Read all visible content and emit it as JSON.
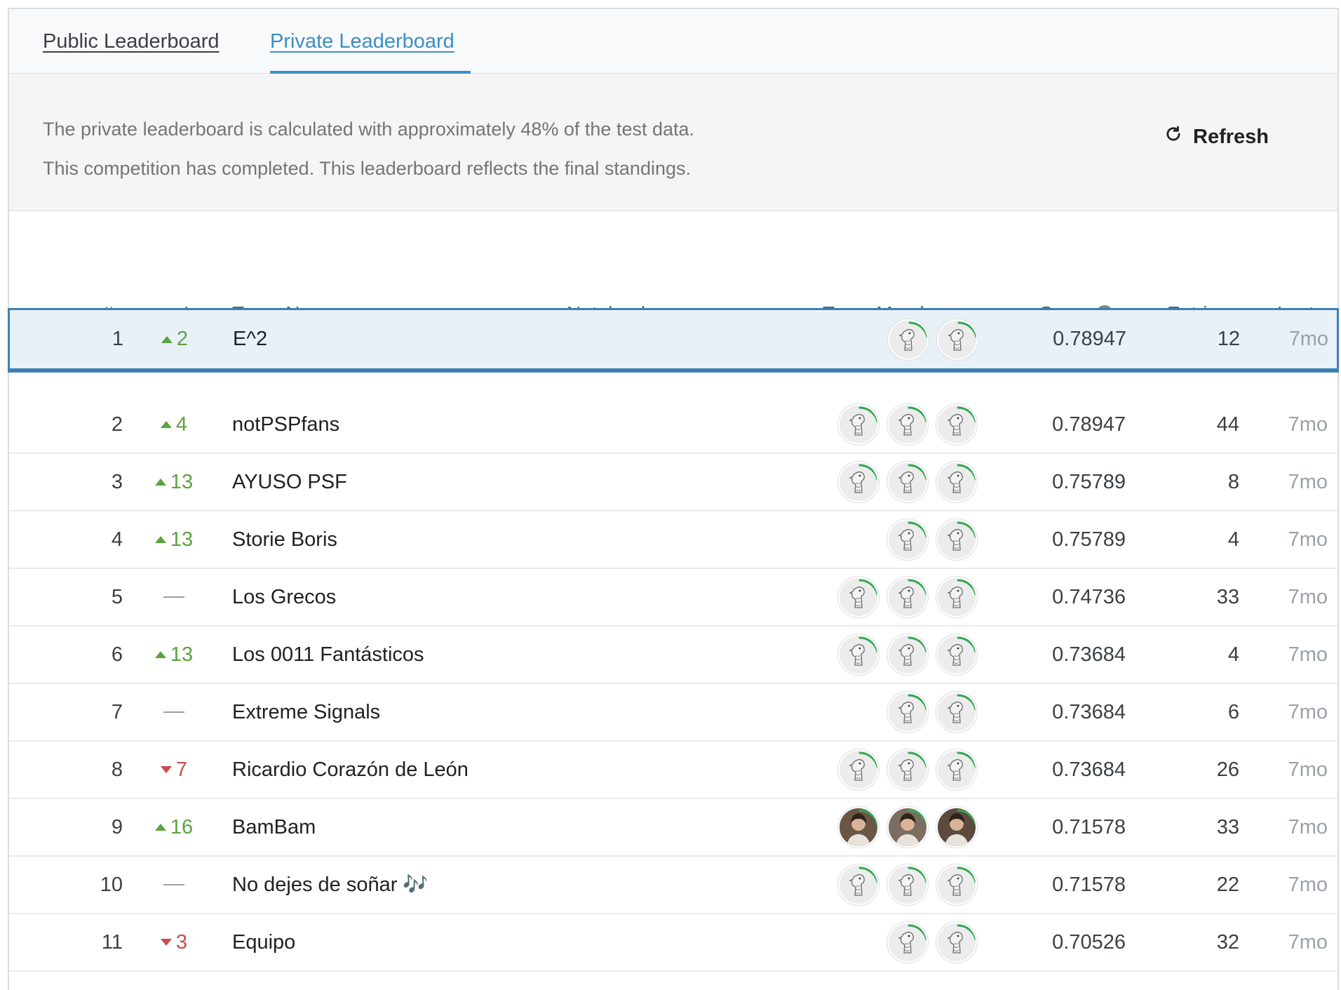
{
  "tabs": {
    "public": "Public Leaderboard",
    "private": "Private Leaderboard",
    "active": "private"
  },
  "notice": {
    "line1": "The private leaderboard is calculated with approximately 48% of the test data.",
    "line2": "This competition has completed. This leaderboard reflects the final standings.",
    "refresh_label": "Refresh"
  },
  "columns": {
    "rank": "#",
    "delta": "△pub",
    "team": "Team Name",
    "notebook": "Notebook",
    "members": "Team Members",
    "score": "Score",
    "entries": "Entries",
    "last": "Last"
  },
  "colors": {
    "accent": "#3d8fc4",
    "up": "#5ba33f",
    "down": "#cc4b4b",
    "selected_bg": "#e8f0f8",
    "progress_arc": "#34a853"
  },
  "rows": [
    {
      "rank": "1",
      "direction": "up",
      "delta": "2",
      "team": "E^2",
      "members": [
        "goose-avatar",
        "goose-avatar"
      ],
      "score": "0.78947",
      "entries": "12",
      "last": "7mo",
      "selected": true
    },
    {
      "rank": "2",
      "direction": "up",
      "delta": "4",
      "team": "notPSPfans",
      "members": [
        "goose-avatar",
        "goose-avatar",
        "goose-avatar"
      ],
      "score": "0.78947",
      "entries": "44",
      "last": "7mo"
    },
    {
      "rank": "3",
      "direction": "up",
      "delta": "13",
      "team": "AYUSO PSF",
      "members": [
        "goose-avatar",
        "goose-avatar",
        "goose-avatar"
      ],
      "score": "0.75789",
      "entries": "8",
      "last": "7mo"
    },
    {
      "rank": "4",
      "direction": "up",
      "delta": "13",
      "team": "Storie Boris",
      "members": [
        "goose-avatar",
        "goose-avatar"
      ],
      "score": "0.75789",
      "entries": "4",
      "last": "7mo"
    },
    {
      "rank": "5",
      "direction": "same",
      "delta": "",
      "team": "Los Grecos",
      "members": [
        "goose-avatar",
        "goose-avatar",
        "goose-avatar"
      ],
      "score": "0.74736",
      "entries": "33",
      "last": "7mo"
    },
    {
      "rank": "6",
      "direction": "up",
      "delta": "13",
      "team": "Los 0011 Fantásticos",
      "members": [
        "goose-avatar",
        "goose-avatar",
        "goose-avatar"
      ],
      "score": "0.73684",
      "entries": "4",
      "last": "7mo"
    },
    {
      "rank": "7",
      "direction": "same",
      "delta": "",
      "team": "Extreme Signals",
      "members": [
        "goose-avatar",
        "goose-avatar"
      ],
      "score": "0.73684",
      "entries": "6",
      "last": "7mo"
    },
    {
      "rank": "8",
      "direction": "down",
      "delta": "7",
      "team": "Ricardio Corazón de León",
      "members": [
        "goose-avatar",
        "goose-avatar",
        "goose-avatar"
      ],
      "score": "0.73684",
      "entries": "26",
      "last": "7mo"
    },
    {
      "rank": "9",
      "direction": "up",
      "delta": "16",
      "team": "BamBam",
      "members": [
        "photo-avatar",
        "photo-avatar",
        "photo-avatar"
      ],
      "score": "0.71578",
      "entries": "33",
      "last": "7mo"
    },
    {
      "rank": "10",
      "direction": "same",
      "delta": "",
      "team": "No dejes de soñar 🎶",
      "members": [
        "goose-avatar",
        "goose-avatar",
        "goose-avatar"
      ],
      "score": "0.71578",
      "entries": "22",
      "last": "7mo"
    },
    {
      "rank": "11",
      "direction": "down",
      "delta": "3",
      "team": "Equipo",
      "members": [
        "goose-avatar",
        "goose-avatar"
      ],
      "score": "0.70526",
      "entries": "32",
      "last": "7mo"
    }
  ]
}
